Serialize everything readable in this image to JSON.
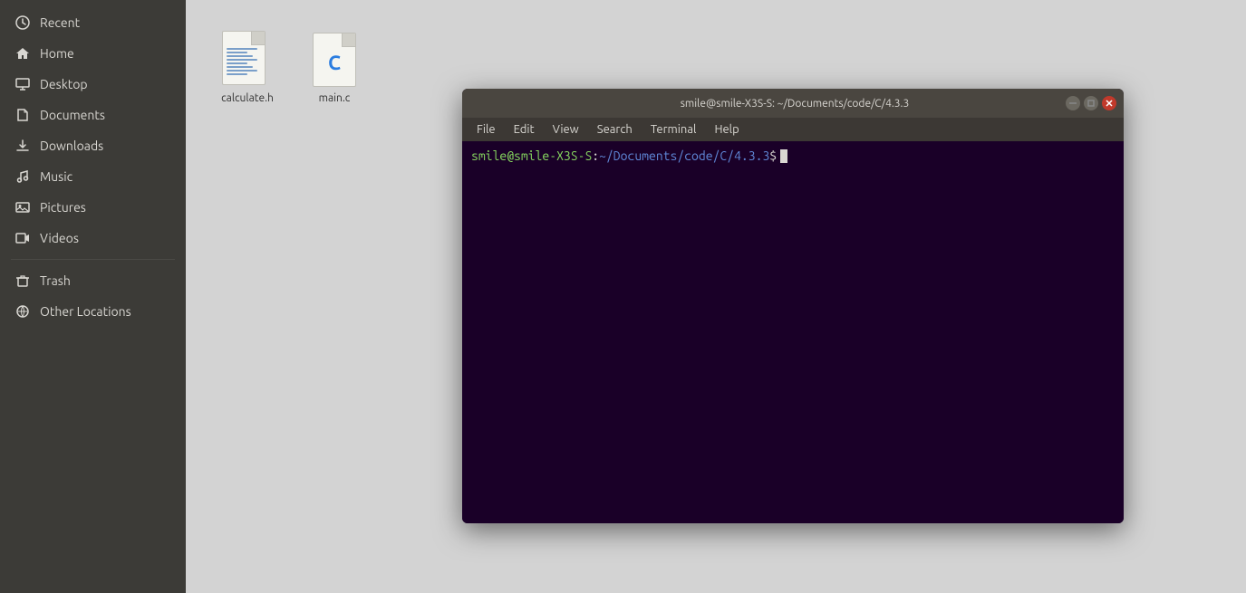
{
  "sidebar": {
    "items": [
      {
        "id": "recent",
        "label": "Recent",
        "icon": "clock"
      },
      {
        "id": "home",
        "label": "Home",
        "icon": "home"
      },
      {
        "id": "desktop",
        "label": "Desktop",
        "icon": "desktop"
      },
      {
        "id": "documents",
        "label": "Documents",
        "icon": "documents"
      },
      {
        "id": "downloads",
        "label": "Downloads",
        "icon": "downloads"
      },
      {
        "id": "music",
        "label": "Music",
        "icon": "music"
      },
      {
        "id": "pictures",
        "label": "Pictures",
        "icon": "pictures"
      },
      {
        "id": "videos",
        "label": "Videos",
        "icon": "videos"
      },
      {
        "id": "trash",
        "label": "Trash",
        "icon": "trash"
      },
      {
        "id": "other-locations",
        "label": "Other Locations",
        "icon": "other-locations"
      }
    ]
  },
  "files": [
    {
      "id": "calculate-h",
      "name": "calculate.h",
      "type": "h"
    },
    {
      "id": "main-c",
      "name": "main.c",
      "type": "c"
    }
  ],
  "terminal": {
    "title": "smile@smile-X3S-S: ~/Documents/code/C/4.3.3",
    "prompt_user_host": "smile@smile-X3S-S",
    "prompt_path": "~/Documents/code/C/4.3.3",
    "menubar": [
      "File",
      "Edit",
      "View",
      "Search",
      "Terminal",
      "Help"
    ]
  }
}
